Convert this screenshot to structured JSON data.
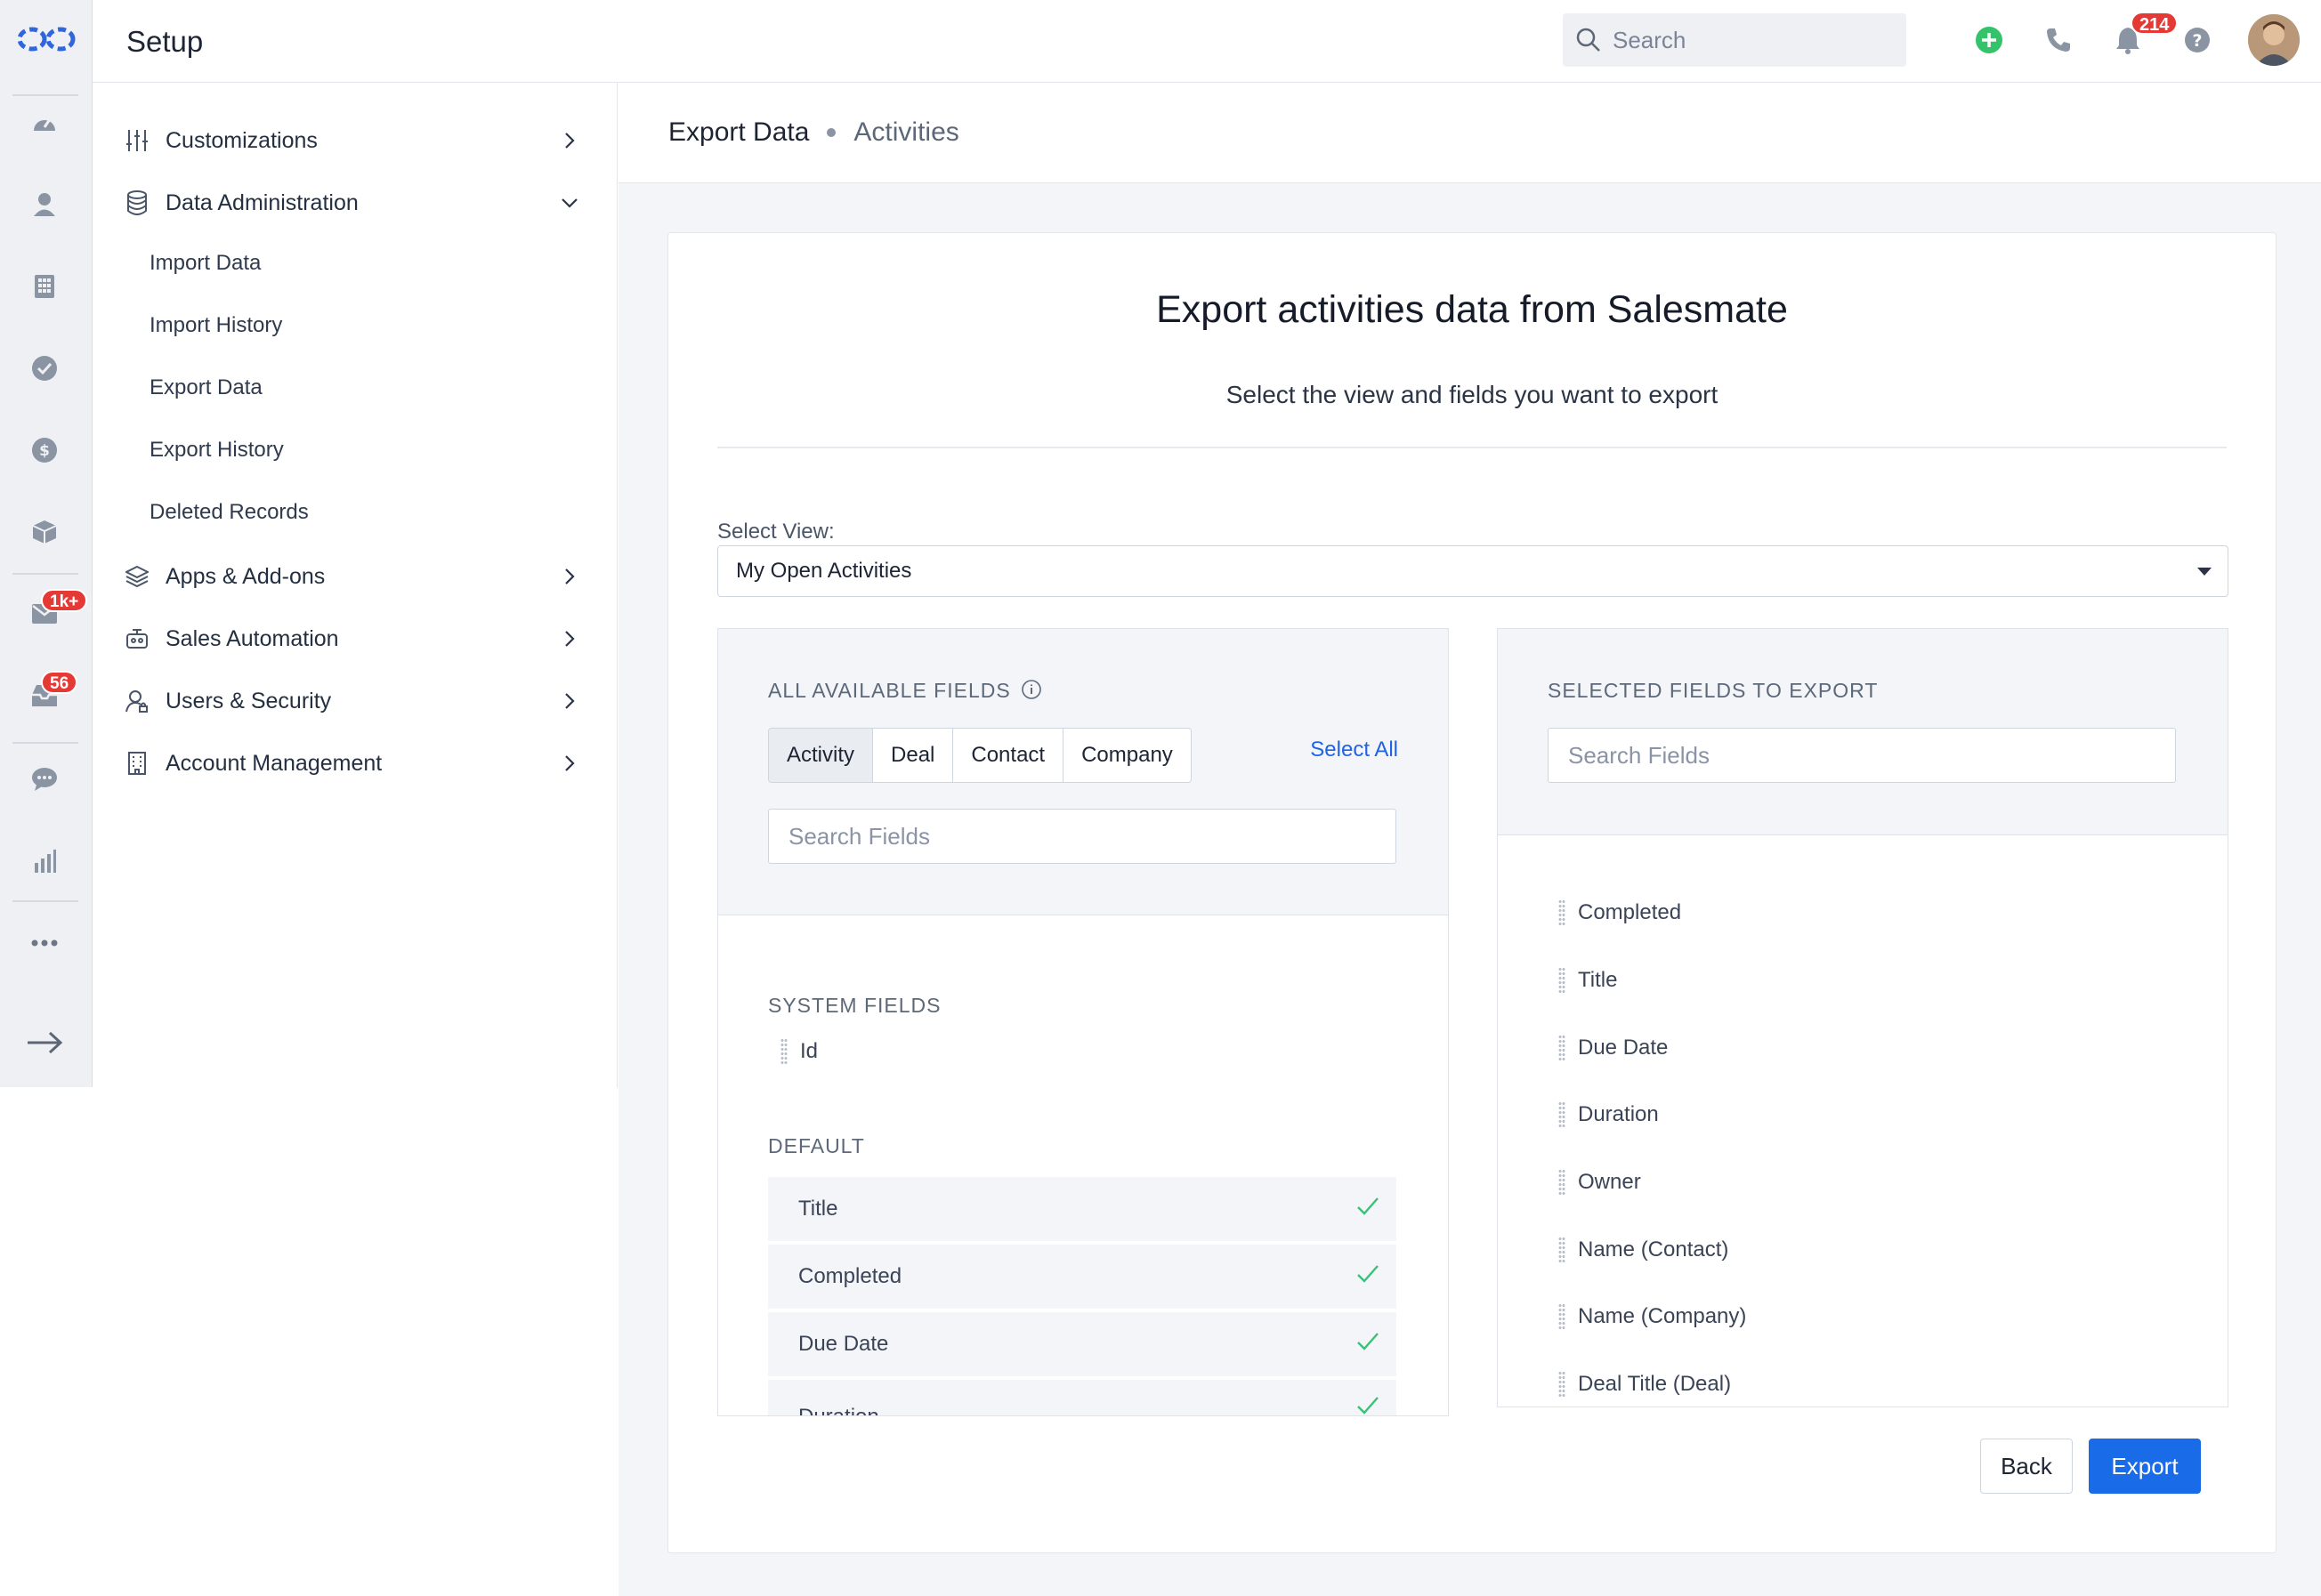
{
  "app": {
    "title": "Setup",
    "search_placeholder": "Search",
    "notifications_count": "214"
  },
  "rail": {
    "icons": [
      "logo-icon",
      "dashboard-icon",
      "contacts-icon",
      "companies-icon",
      "activities-icon",
      "deals-icon",
      "products-icon",
      "email-icon",
      "inbox-icon",
      "chat-icon",
      "reports-icon",
      "more-icon",
      "expand-icon"
    ],
    "email_badge": "1k+",
    "inbox_badge": "56"
  },
  "setup_menu": {
    "items": [
      {
        "label": "Customizations",
        "icon": "sliders-icon"
      },
      {
        "label": "Data Administration",
        "icon": "database-icon"
      },
      {
        "label": "Apps & Add-ons",
        "icon": "layers-icon"
      },
      {
        "label": "Sales Automation",
        "icon": "robot-icon"
      },
      {
        "label": "Users & Security",
        "icon": "user-lock-icon"
      },
      {
        "label": "Account Management",
        "icon": "building-icon"
      }
    ],
    "data_admin_sub": [
      "Import Data",
      "Import History",
      "Export Data",
      "Export History",
      "Deleted Records"
    ]
  },
  "breadcrumb": {
    "parent": "Export Data",
    "current": "Activities"
  },
  "export": {
    "title": "Export activities data from Salesmate",
    "subtitle": "Select the view and fields you want to export",
    "select_view_label": "Select View:",
    "select_view_value": "My Open Activities",
    "available": {
      "title": "ALL AVAILABLE FIELDS",
      "tabs": [
        "Activity",
        "Deal",
        "Contact",
        "Company"
      ],
      "active_tab": "Activity",
      "select_all": "Select All",
      "search_placeholder": "Search Fields",
      "system_label": "SYSTEM FIELDS",
      "system_fields": [
        "Id"
      ],
      "default_label": "DEFAULT",
      "default_fields": [
        "Title",
        "Completed",
        "Due Date",
        "Duration"
      ]
    },
    "selected": {
      "title": "SELECTED FIELDS TO EXPORT",
      "search_placeholder": "Search Fields",
      "fields": [
        "Completed",
        "Title",
        "Due Date",
        "Duration",
        "Owner",
        "Name (Contact)",
        "Name (Company)",
        "Deal Title (Deal)"
      ]
    },
    "back_label": "Back",
    "export_label": "Export"
  },
  "colors": {
    "accent": "#1a6be8",
    "check": "#3cbf7a",
    "badge": "#e53935",
    "add": "#34c36b"
  }
}
